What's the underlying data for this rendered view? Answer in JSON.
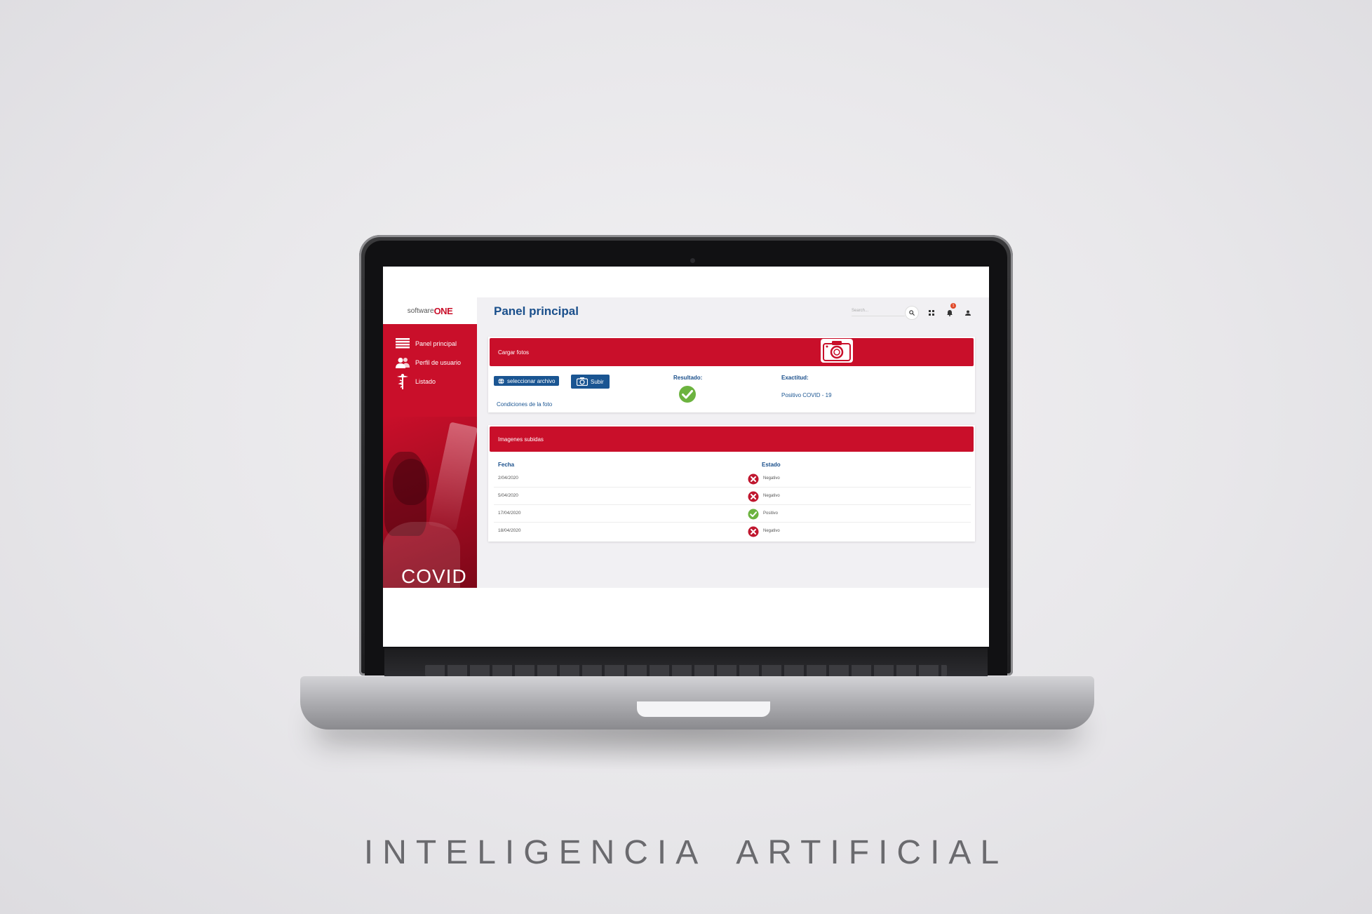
{
  "app": {
    "logo": {
      "prefix": "software",
      "brand": "ONE"
    },
    "page_title": "Panel principal",
    "search": {
      "placeholder": "Search..."
    },
    "notification_count": "1",
    "sidebar": {
      "items": [
        {
          "label": "Panel principal",
          "icon": "list-icon"
        },
        {
          "label": "Perfil de usuario",
          "icon": "users-icon"
        },
        {
          "label": "Listado",
          "icon": "caduceus-icon"
        }
      ],
      "banner_text": "COVID"
    },
    "upload_card": {
      "header": "Cargar fotos",
      "select_label": "seleccionar archivo",
      "upload_label": "Subir",
      "conditions_link": "Condiciones de la foto",
      "result_label": "Resultado:",
      "accuracy_label": "Exactitud:",
      "accuracy_value": "Positivo COVID - 19"
    },
    "images_card": {
      "header": "Imagenes subidas",
      "columns": {
        "date": "Fecha",
        "status": "Estado"
      },
      "rows": [
        {
          "date": "2/04/2020",
          "status": "Negativo",
          "ok": false
        },
        {
          "date": "5/04/2020",
          "status": "Negativo",
          "ok": false
        },
        {
          "date": "17/04/2020",
          "status": "Positivo",
          "ok": true
        },
        {
          "date": "18/04/2020",
          "status": "Negativo",
          "ok": false
        }
      ]
    }
  },
  "caption": "INTELIGENCIA ARTIFICIAL",
  "colors": {
    "brand_red": "#c90f2a",
    "brand_blue": "#1a4f8b",
    "ok_green": "#6cb33f",
    "error_red": "#c0172f"
  }
}
